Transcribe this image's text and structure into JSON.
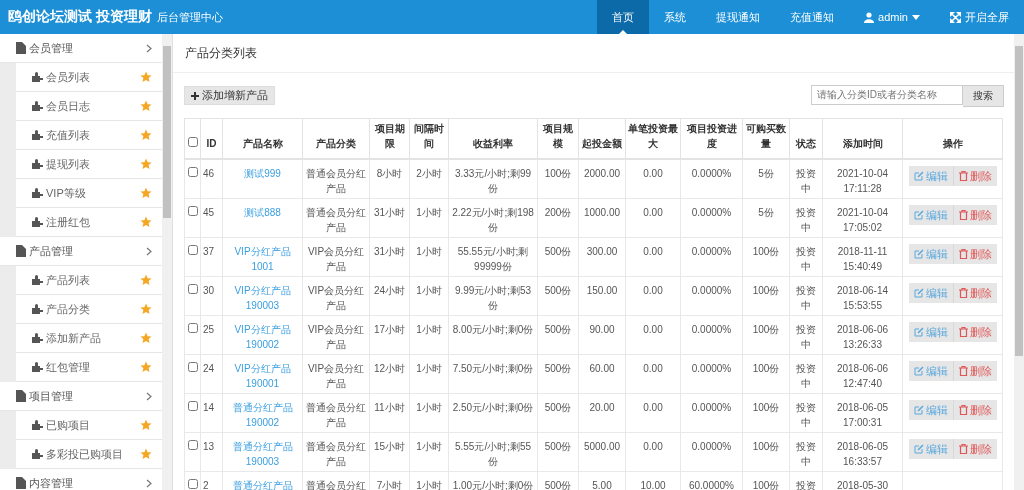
{
  "header": {
    "brand": "鸥创论坛测试 投资理财",
    "subtitle": "后台管理中心",
    "nav": [
      {
        "label": "首页",
        "selected": true
      },
      {
        "label": "系统",
        "selected": false
      },
      {
        "label": "提现通知",
        "selected": false
      },
      {
        "label": "充值通知",
        "selected": false
      }
    ],
    "user": "admin",
    "fullscreen": "开启全屏"
  },
  "sidebar": {
    "groups": [
      {
        "label": "会员管理",
        "children": [
          "会员列表",
          "会员日志",
          "充值列表",
          "提现列表",
          "VIP等级",
          "注册红包"
        ]
      },
      {
        "label": "产品管理",
        "children": [
          "产品列表",
          "产品分类",
          "添加新产品",
          "红包管理"
        ]
      },
      {
        "label": "项目管理",
        "children": [
          "已购项目",
          "多彩投已购项目"
        ]
      },
      {
        "label": "内容管理"
      }
    ]
  },
  "main": {
    "title": "产品分类列表",
    "add_button": "添加增新产品",
    "search": {
      "placeholder": "请输入分类ID或者分类名称"
    },
    "search_button": "搜索",
    "table": {
      "select_all_checked": false,
      "columns": [
        "ID",
        "产品名称",
        "产品分类",
        "项目期限",
        "间隔时间",
        "收益利率",
        "项目规模",
        "起投金额",
        "单笔投资最大",
        "项目投资进度",
        "可购买数量",
        "状态",
        "添加时间",
        "操作"
      ],
      "rows": [
        {
          "checked": false,
          "cells": [
            "46",
            "测试999",
            "普通会员分红产品",
            "8小时",
            "2小时",
            "3.33元/小时;剩99份",
            "100份",
            "2000.00",
            "0.00",
            "0.0000%",
            "5份",
            "投资中",
            "2021-10-04 17:11:28"
          ],
          "edit": "编辑",
          "delete": "删除"
        },
        {
          "checked": false,
          "cells": [
            "45",
            "测试888",
            "普通会员分红产品",
            "31小时",
            "1小时",
            "2.22元/小时;剩198份",
            "200份",
            "1000.00",
            "0.00",
            "0.0000%",
            "5份",
            "投资中",
            "2021-10-04 17:05:02"
          ],
          "edit": "编辑",
          "delete": "删除"
        },
        {
          "checked": false,
          "cells": [
            "37",
            "VIP分红产品1001",
            "VIP会员分红产品",
            "31小时",
            "1小时",
            "55.55元/小时;剩99999份",
            "500份",
            "300.00",
            "0.00",
            "0.0000%",
            "100份",
            "投资中",
            "2018-11-11 15:40:49"
          ],
          "edit": "编辑",
          "delete": "删除"
        },
        {
          "checked": false,
          "cells": [
            "30",
            "VIP分红产品190003",
            "VIP会员分红产品",
            "24小时",
            "1小时",
            "9.99元/小时;剩53份",
            "500份",
            "150.00",
            "0.00",
            "0.0000%",
            "100份",
            "投资中",
            "2018-06-14 15:53:55"
          ],
          "edit": "编辑",
          "delete": "删除"
        },
        {
          "checked": false,
          "cells": [
            "25",
            "VIP分红产品190002",
            "VIP会员分红产品",
            "17小时",
            "1小时",
            "8.00元/小时;剩0份",
            "500份",
            "90.00",
            "0.00",
            "0.0000%",
            "100份",
            "投资中",
            "2018-06-06 13:26:33"
          ],
          "edit": "编辑",
          "delete": "删除"
        },
        {
          "checked": false,
          "cells": [
            "24",
            "VIP分红产品190001",
            "VIP会员分红产品",
            "12小时",
            "1小时",
            "7.50元/小时;剩0份",
            "500份",
            "60.00",
            "0.00",
            "0.0000%",
            "100份",
            "投资中",
            "2018-06-06 12:47:40"
          ],
          "edit": "编辑",
          "delete": "删除"
        },
        {
          "checked": false,
          "cells": [
            "14",
            "普通分红产品190002",
            "普通会员分红产品",
            "11小时",
            "1小时",
            "2.50元/小时;剩0份",
            "500份",
            "20.00",
            "0.00",
            "0.0000%",
            "100份",
            "投资中",
            "2018-06-05 17:00:31"
          ],
          "edit": "编辑",
          "delete": "删除"
        },
        {
          "checked": false,
          "cells": [
            "13",
            "普通分红产品190003",
            "普通会员分红产品",
            "15小时",
            "1小时",
            "5.55元/小时;剩55份",
            "500份",
            "5000.00",
            "0.00",
            "0.0000%",
            "100份",
            "投资中",
            "2018-06-05 16:33:57"
          ],
          "edit": "编辑",
          "delete": "删除"
        },
        {
          "checked": false,
          "cells": [
            "2",
            "普通分红产品",
            "普通会员分红",
            "7小时",
            "1小时",
            "1.00元/小时;剩0份",
            "500份",
            "5.00",
            "10.00",
            "60.0000%",
            "100份",
            "投资",
            "2018-05-30"
          ]
        }
      ]
    }
  }
}
